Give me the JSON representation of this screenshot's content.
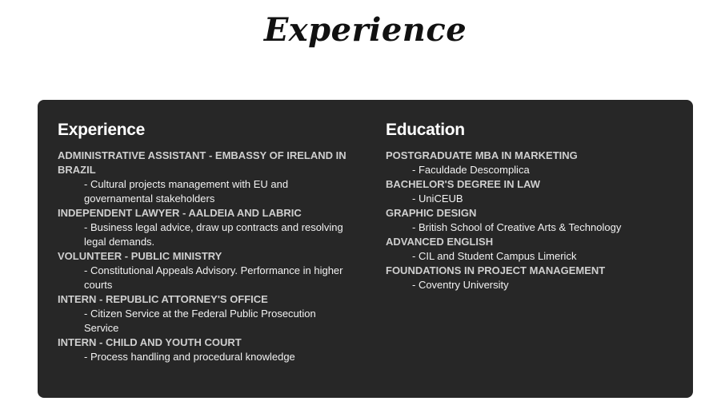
{
  "page": {
    "title": "Experience"
  },
  "experience": {
    "heading": "Experience",
    "items": [
      {
        "title": "ADMINISTRATIVE ASSISTANT - EMBASSY OF IRELAND IN BRAZIL",
        "detail": "- Cultural projects management with EU and governamental stakeholders"
      },
      {
        "title": "INDEPENDENT LAWYER - AALDEIA AND LABRIC",
        "detail": "- Business legal advice, draw up contracts and resolving legal demands."
      },
      {
        "title": "VOLUNTEER - PUBLIC MINISTRY",
        "detail": "- Constitutional Appeals Advisory. Performance in higher courts"
      },
      {
        "title": "INTERN - REPUBLIC ATTORNEY'S OFFICE",
        "detail": "- Citizen Service at the Federal Public Prosecution Service"
      },
      {
        "title": "INTERN - CHILD AND YOUTH COURT",
        "detail": "- Process handling and procedural knowledge"
      }
    ]
  },
  "education": {
    "heading": "Education",
    "items": [
      {
        "title": "POSTGRADUATE MBA IN MARKETING",
        "detail": "- Faculdade Descomplica"
      },
      {
        "title": "BACHELOR'S DEGREE IN LAW",
        "detail": "- UniCEUB"
      },
      {
        "title": "GRAPHIC DESIGN",
        "detail": "- British School of Creative Arts & Technology"
      },
      {
        "title": "ADVANCED ENGLISH",
        "detail": "- CIL and Student Campus Limerick"
      },
      {
        "title": "FOUNDATIONS IN PROJECT MANAGEMENT",
        "detail": "- Coventry University"
      }
    ]
  },
  "colors": {
    "card_background": "#272727",
    "page_background": "#ffffff",
    "heading_text": "#ffffff",
    "entry_title_text": "#cfcfcf",
    "entry_detail_text": "#f2f2f2"
  }
}
